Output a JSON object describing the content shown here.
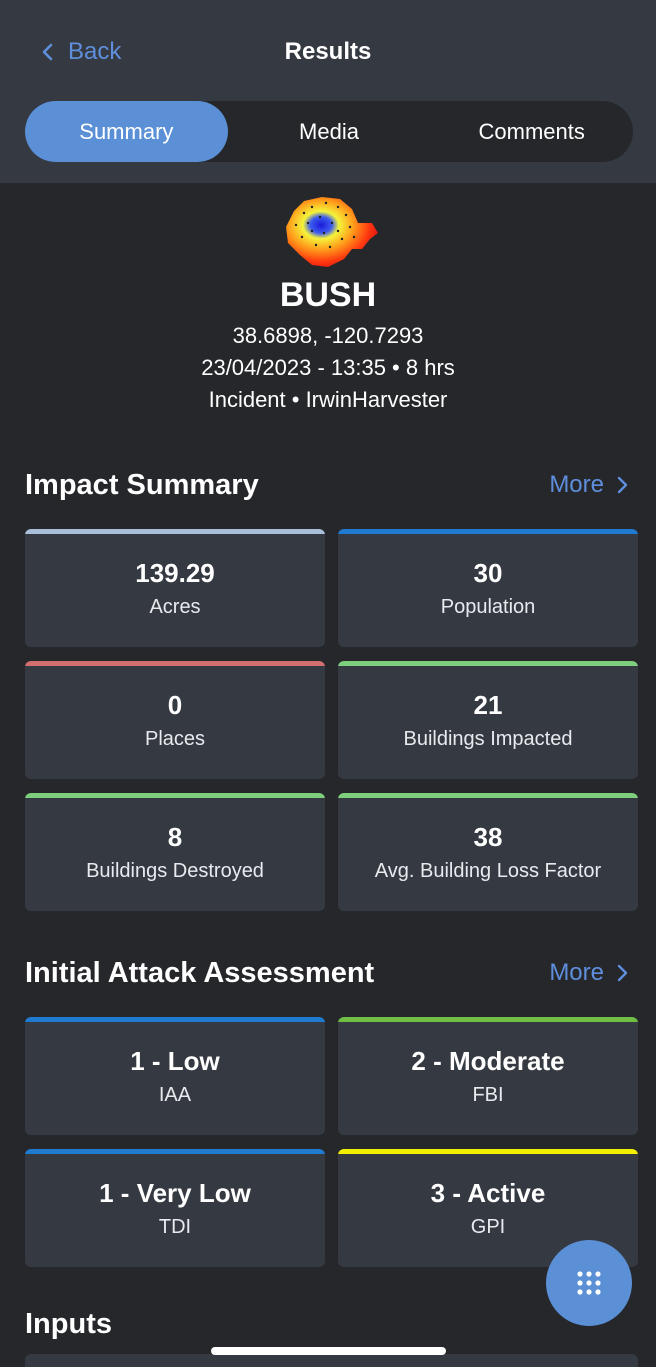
{
  "header": {
    "back_label": "Back",
    "title": "Results",
    "tabs": [
      {
        "label": "Summary",
        "active": true
      },
      {
        "label": "Media",
        "active": false
      },
      {
        "label": "Comments",
        "active": false
      }
    ]
  },
  "incident": {
    "icon": "fire-perimeter-heatmap-icon",
    "name": "BUSH",
    "coordinates": "38.6898, -120.7293",
    "datetime": "23/04/2023 - 13:35 • 8 hrs",
    "source": "Incident • IrwinHarvester"
  },
  "impact_summary": {
    "title": "Impact Summary",
    "more_label": "More",
    "cards": [
      {
        "value": "139.29",
        "label": "Acres",
        "color": "#a9bfd9"
      },
      {
        "value": "30",
        "label": "Population",
        "color": "#1f7bd0"
      },
      {
        "value": "0",
        "label": "Places",
        "color": "#d46f6f"
      },
      {
        "value": "21",
        "label": "Buildings Impacted",
        "color": "#7dce7d"
      },
      {
        "value": "8",
        "label": "Buildings Destroyed",
        "color": "#7dce7d"
      },
      {
        "value": "38",
        "label": "Avg. Building Loss Factor",
        "color": "#7dce7d"
      }
    ]
  },
  "initial_attack": {
    "title": "Initial Attack Assessment",
    "more_label": "More",
    "cards": [
      {
        "value": "1 - Low",
        "label": "IAA",
        "color": "#1f7bd0"
      },
      {
        "value": "2 - Moderate",
        "label": "FBI",
        "color": "#6fbf45"
      },
      {
        "value": "1 - Very Low",
        "label": "TDI",
        "color": "#1f7bd0"
      },
      {
        "value": "3 - Active",
        "label": "GPI",
        "color": "#f2ef00"
      }
    ]
  },
  "inputs": {
    "title": "Inputs"
  },
  "fab": {
    "icon": "grid-menu-icon"
  },
  "colors": {
    "accent": "#5b8fd6",
    "link": "#5f8fdc",
    "background": "#25272b",
    "card": "#353a42"
  }
}
